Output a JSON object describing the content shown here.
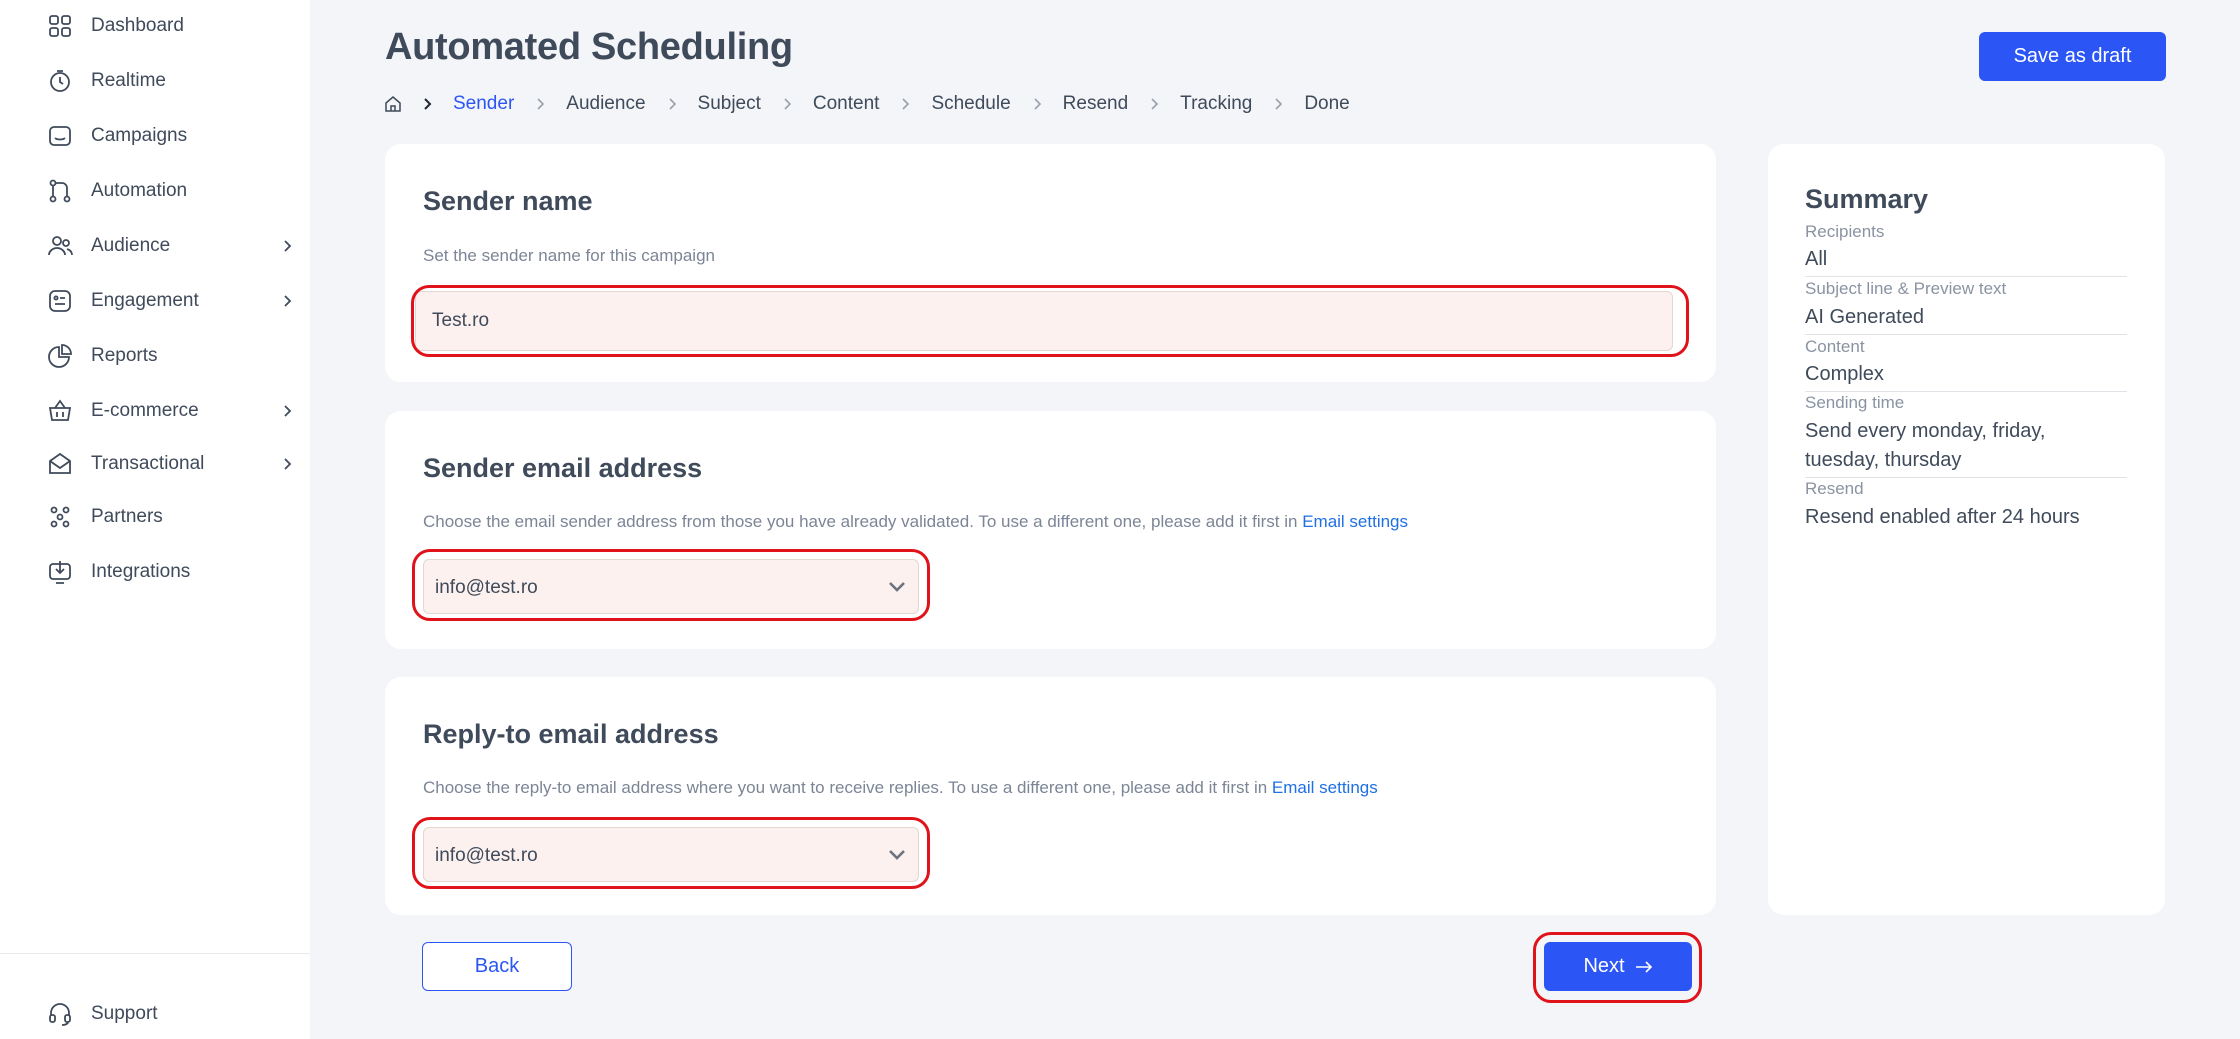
{
  "sidebar": {
    "items": [
      {
        "label": "Dashboard",
        "icon": "dashboard-icon"
      },
      {
        "label": "Realtime",
        "icon": "stopwatch-icon"
      },
      {
        "label": "Campaigns",
        "icon": "folder-icon"
      },
      {
        "label": "Automation",
        "icon": "workflow-icon"
      },
      {
        "label": "Audience",
        "icon": "users-icon"
      },
      {
        "label": "Engagement",
        "icon": "engagement-icon"
      },
      {
        "label": "Reports",
        "icon": "pie-chart-icon"
      },
      {
        "label": "E-commerce",
        "icon": "basket-icon"
      },
      {
        "label": "Transactional",
        "icon": "envelope-icon"
      },
      {
        "label": "Partners",
        "icon": "partners-icon"
      },
      {
        "label": "Integrations",
        "icon": "download-icon"
      }
    ],
    "support_label": "Support"
  },
  "header": {
    "title": "Automated Scheduling",
    "save_draft_label": "Save as draft"
  },
  "breadcrumb": {
    "steps": [
      "Sender",
      "Audience",
      "Subject",
      "Content",
      "Schedule",
      "Resend",
      "Tracking",
      "Done"
    ],
    "active_step": "Sender"
  },
  "sender_name": {
    "title": "Sender name",
    "description": "Set the sender name for this campaign",
    "value": "Test.ro"
  },
  "sender_email": {
    "title": "Sender email address",
    "description": "Choose the email sender address from those you have already validated. To use a different one, please add it first in ",
    "link_label": "Email settings",
    "selected": "info@test.ro"
  },
  "reply_to": {
    "title": "Reply-to email address",
    "description": "Choose the reply-to email address where you want to receive replies. To use a different one, please add it first in ",
    "link_label": "Email settings",
    "selected": "info@test.ro"
  },
  "summary": {
    "title": "Summary",
    "rows": [
      {
        "label": "Recipients",
        "value": "All"
      },
      {
        "label": "Subject line & Preview text",
        "value": "AI Generated"
      },
      {
        "label": "Content",
        "value": "Complex"
      },
      {
        "label": "Sending time",
        "value": "Send every monday, friday, tuesday, thursday"
      },
      {
        "label": "Resend",
        "value": "Resend enabled after 24 hours"
      }
    ]
  },
  "footer": {
    "back_label": "Back",
    "next_label": "Next"
  },
  "colors": {
    "accent": "#2b56f5",
    "highlight": "#e0131b",
    "link": "#1f6fe5",
    "input_bg": "#fdf1ef"
  }
}
